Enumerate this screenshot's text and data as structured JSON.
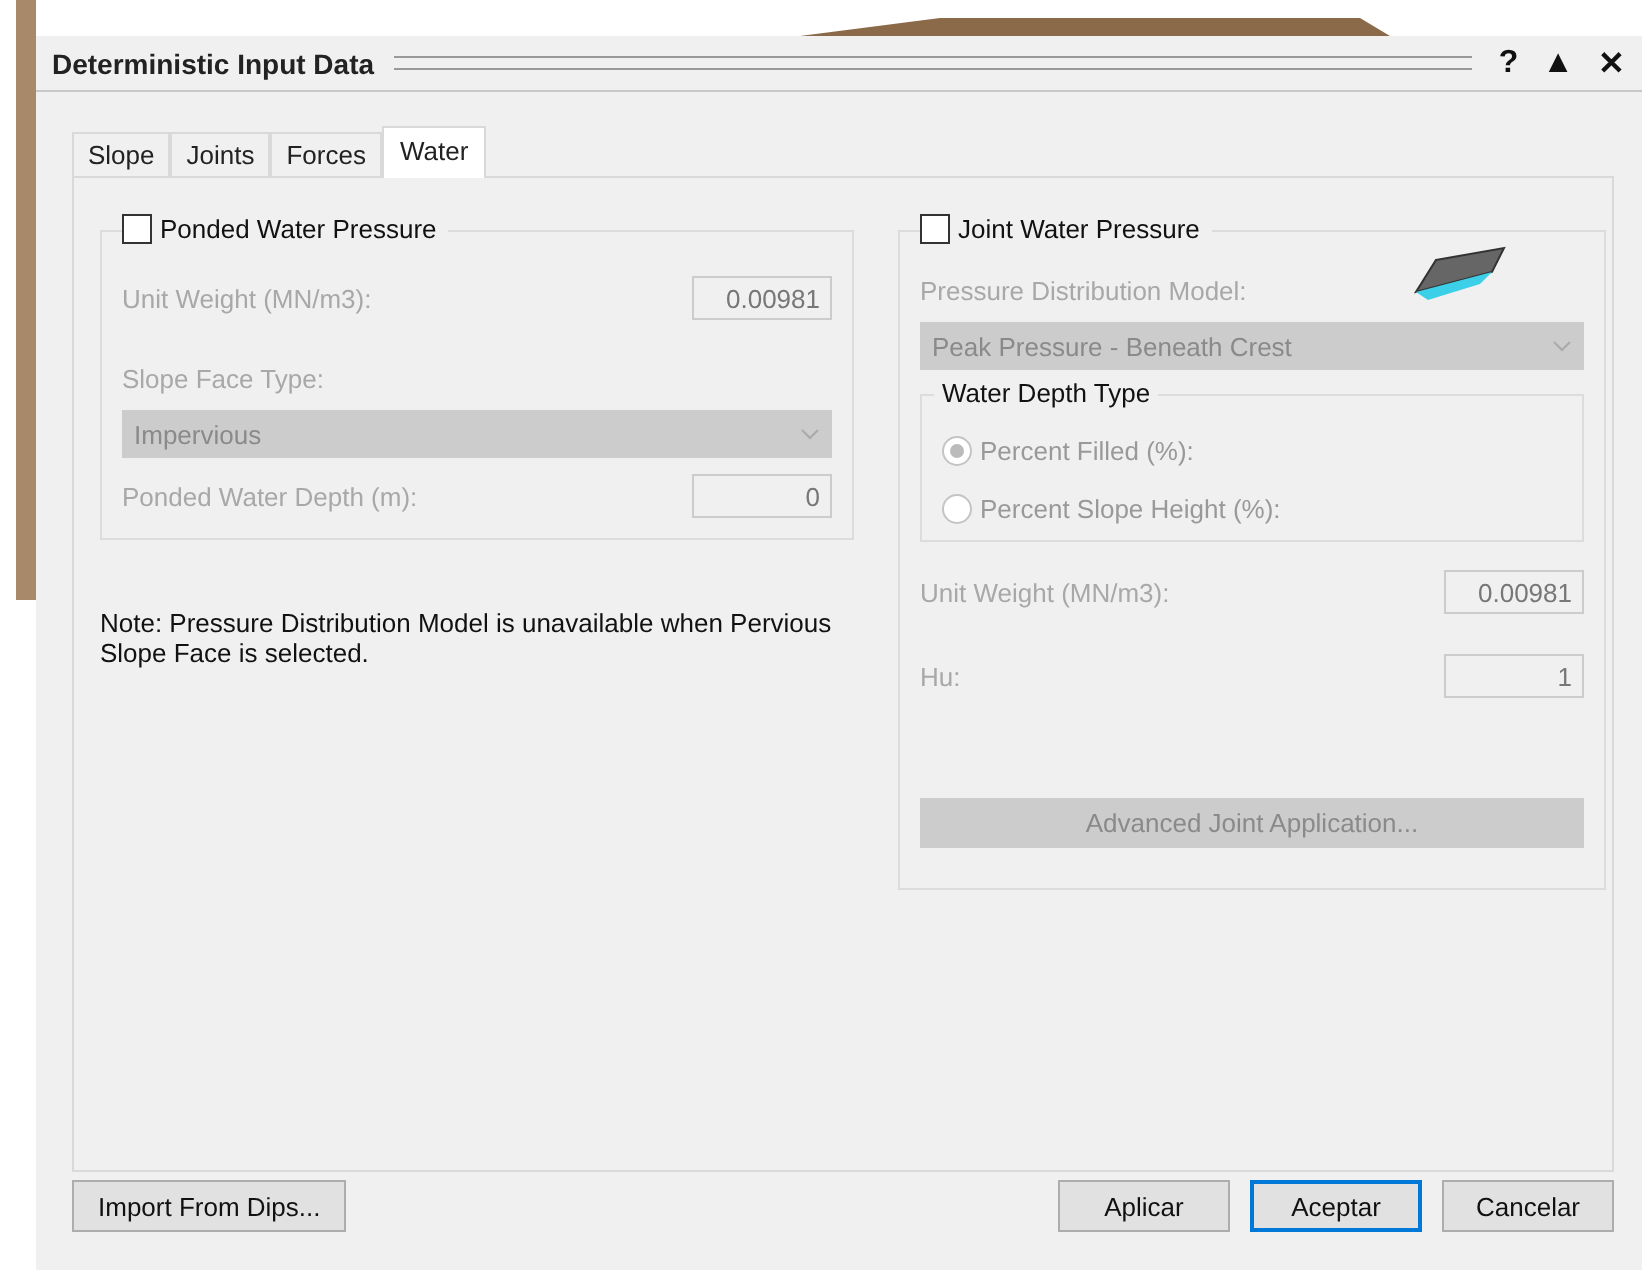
{
  "window": {
    "title": "Deterministic Input Data",
    "controls": [
      "?",
      "▲",
      "✕"
    ]
  },
  "tabs": [
    {
      "label": "Slope",
      "selected": false
    },
    {
      "label": "Joints",
      "selected": false
    },
    {
      "label": "Forces",
      "selected": false
    },
    {
      "label": "Water",
      "selected": true
    }
  ],
  "ponded": {
    "label": "Ponded Water Pressure",
    "checked": false,
    "disabled": true,
    "unit_weight": {
      "label": "Unit Weight (MN/m3):",
      "value": "0.00981"
    },
    "slope_face": {
      "label": "Slope Face Type:",
      "value": "Impervious"
    },
    "depth": {
      "label": "Ponded Water Depth (m):",
      "value": "0"
    }
  },
  "note": "Note: Pressure Distribution Model is unavailable when Pervious Slope Face is selected.",
  "joint": {
    "label": "Joint Water Pressure",
    "checked": false,
    "disabled": true,
    "model": {
      "label": "Pressure Distribution Model:",
      "value": "Peak Pressure - Beneath Crest"
    },
    "depth_type": {
      "title": "Water Depth Type",
      "options": [
        {
          "label": "Percent Filled (%):",
          "selected": true
        },
        {
          "label": "Percent Slope Height (%):",
          "selected": false
        }
      ]
    },
    "unit_weight": {
      "label": "Unit Weight (MN/m3):",
      "value": "0.00981"
    },
    "hu": {
      "label": "Hu:",
      "value": "1"
    },
    "advanced": "Advanced Joint Application..."
  },
  "buttons": [
    {
      "label": "Import From Dips...",
      "kind": "left",
      "default": false
    },
    {
      "label": "Aplicar",
      "kind": "right",
      "default": false
    },
    {
      "label": "Aceptar",
      "kind": "right",
      "default": true
    },
    {
      "label": "Cancelar",
      "kind": "right",
      "default": false
    }
  ]
}
